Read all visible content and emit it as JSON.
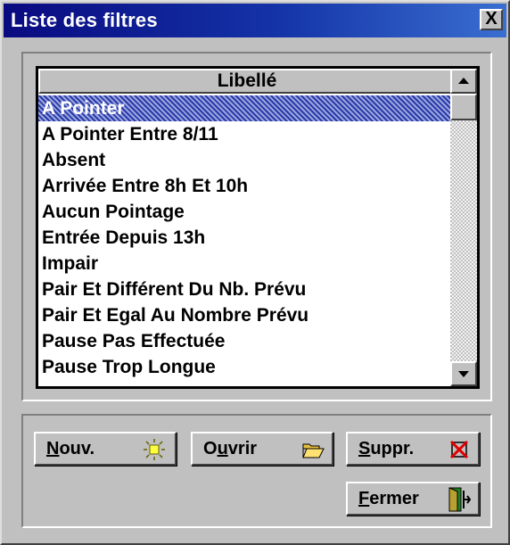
{
  "window": {
    "title": "Liste des filtres",
    "close_symbol": "X"
  },
  "list": {
    "header": "Libellé",
    "selected_index": 0,
    "items": [
      "A Pointer",
      "A Pointer Entre 8/11",
      "Absent",
      "Arrivée Entre 8h Et 10h",
      "Aucun Pointage",
      "Entrée Depuis 13h",
      "Impair",
      "Pair Et Différent Du Nb. Prévu",
      "Pair Et Egal Au Nombre Prévu",
      "Pause Pas Effectuée",
      "Pause Trop Longue"
    ]
  },
  "buttons": {
    "new": {
      "mnemonic": "N",
      "rest": "ouv.",
      "icon": "sun-icon"
    },
    "open": {
      "pre": "O",
      "mnemonic": "u",
      "rest": "vrir",
      "icon": "open-folder-icon"
    },
    "delete": {
      "mnemonic": "S",
      "rest": "uppr.",
      "icon": "delete-x-icon"
    },
    "close": {
      "mnemonic": "F",
      "rest": "ermer",
      "icon": "exit-door-icon"
    }
  },
  "colors": {
    "titlebar_start": "#0a0a80",
    "titlebar_end": "#3a6ed0",
    "selection": "#2a3aa8",
    "face": "#c0c0c0"
  }
}
